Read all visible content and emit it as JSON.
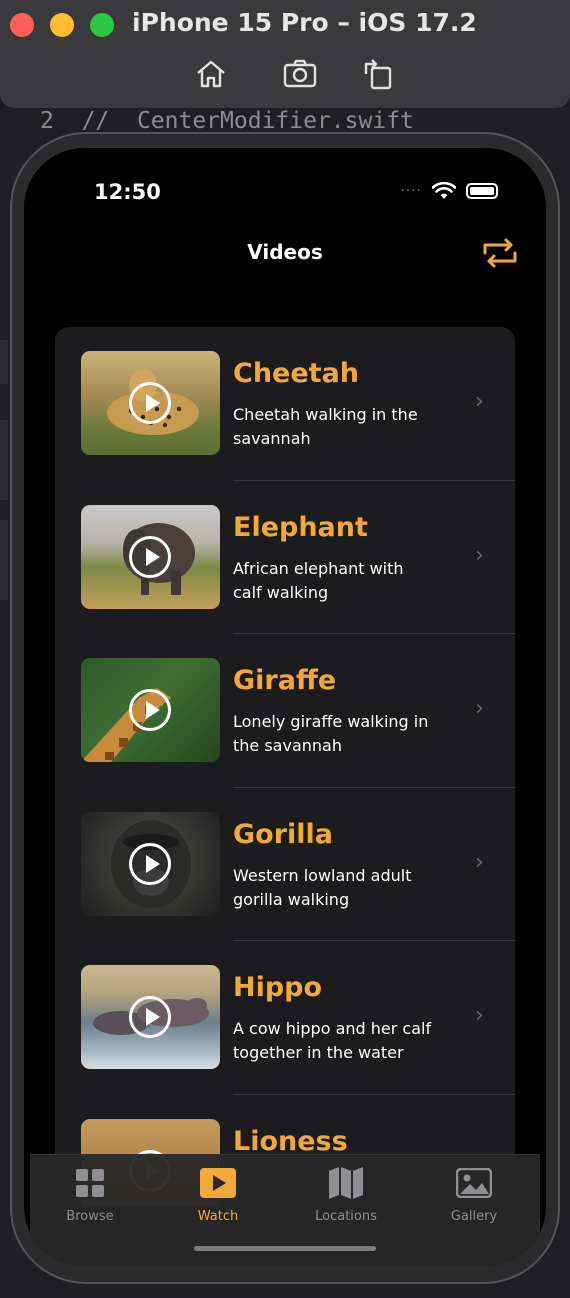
{
  "window": {
    "title": "iPhone 15 Pro – iOS 17.2"
  },
  "editor": {
    "line_number": "2",
    "code_text": "//  CenterModifier.swift"
  },
  "status": {
    "time": "12:50",
    "signal_dots": "····"
  },
  "nav": {
    "title": "Videos"
  },
  "videos": [
    {
      "title": "Cheetah",
      "subtitle": "Cheetah walking in the savannah"
    },
    {
      "title": "Elephant",
      "subtitle": "African elephant with calf walking"
    },
    {
      "title": "Giraffe",
      "subtitle": "Lonely giraffe walking in the savannah"
    },
    {
      "title": "Gorilla",
      "subtitle": "Western lowland adult gorilla walking"
    },
    {
      "title": "Hippo",
      "subtitle": "A cow hippo and her calf together in the water"
    },
    {
      "title": "Lioness",
      "subtitle": ""
    }
  ],
  "tabs": [
    {
      "label": "Browse",
      "icon": "grid-icon",
      "active": false
    },
    {
      "label": "Watch",
      "icon": "play-square-icon",
      "active": true
    },
    {
      "label": "Locations",
      "icon": "map-icon",
      "active": false
    },
    {
      "label": "Gallery",
      "icon": "photo-icon",
      "active": false
    }
  ],
  "colors": {
    "accent": "#F3A93A",
    "list_bg": "#1C1C1E",
    "screen_bg": "#000000"
  }
}
